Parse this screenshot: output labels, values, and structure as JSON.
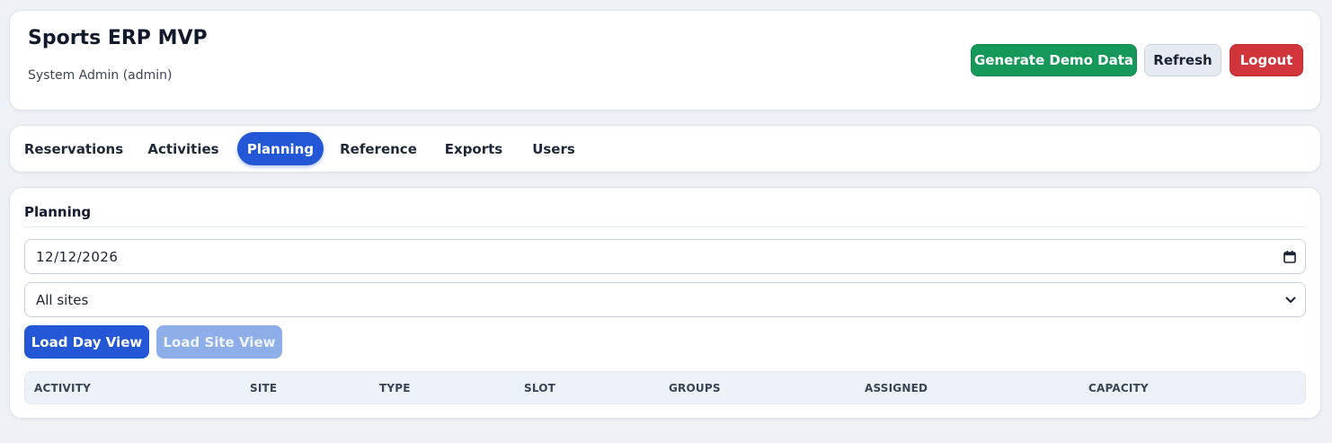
{
  "header": {
    "title": "Sports ERP MVP",
    "user": "System Admin (admin)",
    "buttons": {
      "generate": "Generate Demo Data",
      "refresh": "Refresh",
      "logout": "Logout"
    }
  },
  "nav": {
    "tabs": [
      {
        "label": "Reservations",
        "active": false
      },
      {
        "label": "Activities",
        "active": false
      },
      {
        "label": "Planning",
        "active": true
      },
      {
        "label": "Reference",
        "active": false
      },
      {
        "label": "Exports",
        "active": false
      },
      {
        "label": "Users",
        "active": false
      }
    ]
  },
  "planning": {
    "title": "Planning",
    "date_value": "12/12/2026",
    "site_value": "All sites",
    "buttons": {
      "day_view": "Load Day View",
      "site_view": "Load Site View"
    },
    "table_columns": [
      "ACTIVITY",
      "SITE",
      "TYPE",
      "SLOT",
      "GROUPS",
      "ASSIGNED",
      "CAPACITY"
    ]
  },
  "colors": {
    "accent": "#2457d6",
    "success": "#15985a",
    "danger": "#d1343b",
    "disabled_accent": "#8eaee9"
  },
  "icons": {
    "date_picker": "calendar-icon",
    "select": "chevron-down-icon"
  }
}
